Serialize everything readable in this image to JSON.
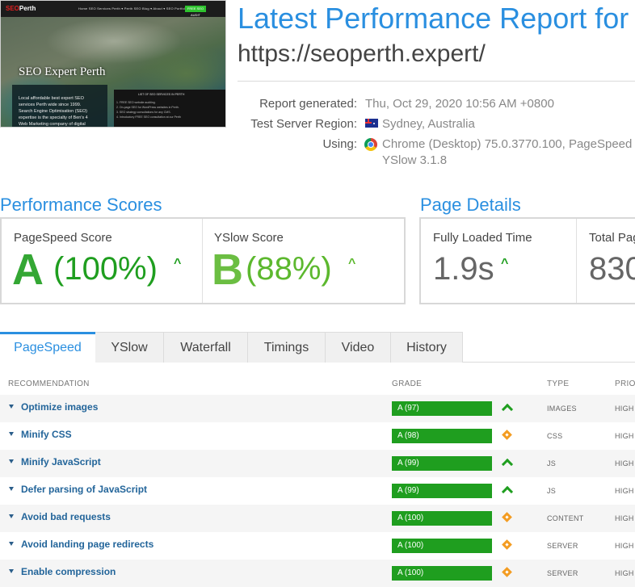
{
  "thumbnail": {
    "logo_brand": "SEO",
    "logo_rest": "Perth",
    "nav_links": "Home   SEO Services Perth ▾   Perth SEO Blog ▾   About ▾   SEO Portfolio",
    "nav_button": "FREE SEO AUDIT",
    "hero": "SEO Expert Perth",
    "hero_sub": "Local affordable best expert SEO",
    "text_lines": [
      "Local affordable best expert SEO",
      "services Perth wide since 1999.",
      "Search Engine Optimisation (SEO)",
      "expertise is the specialty of Ben's 4",
      "Web Marketing company of digital"
    ],
    "panel_title": "LIST OF SEO SERVICES IN PERTH",
    "panel_lines": [
      "1. FREE SEO website auditing.",
      "2. On-page SEO for WordPress websites in Perth.",
      "3. SEO strategy consultations for any CMS.",
      "4. Introductory FREE SEO consultation at our Perth"
    ]
  },
  "header": {
    "title": "Latest Performance Report for",
    "url": "https://seoperth.expert/"
  },
  "meta": {
    "report_generated_label": "Report generated:",
    "report_generated_value": "Thu, Oct 29, 2020 10:56 AM +0800",
    "region_label": "Test Server Region:",
    "region_value": "Sydney, Australia",
    "using_label": "Using:",
    "using_value_line1": "Chrome (Desktop) 75.0.3770.100, PageSpeed",
    "using_value_line2": "YSlow 3.1.8"
  },
  "performance_scores": {
    "title": "Performance Scores",
    "pagespeed": {
      "label": "PageSpeed Score",
      "grade": "A",
      "percent": "(100%)",
      "color": "#1f9e1f"
    },
    "yslow": {
      "label": "YSlow Score",
      "grade": "B",
      "percent": "(88%)",
      "color": "#5cb82e"
    }
  },
  "page_details": {
    "title": "Page Details",
    "fully_loaded": {
      "label": "Fully Loaded Time",
      "value": "1.9s"
    },
    "total_page": {
      "label": "Total Pag",
      "value": "830"
    }
  },
  "tabs": [
    "PageSpeed",
    "YSlow",
    "Waterfall",
    "Timings",
    "Video",
    "History"
  ],
  "table": {
    "headers": {
      "recommendation": "RECOMMENDATION",
      "grade": "GRADE",
      "type": "TYPE",
      "priority": "PRIO"
    },
    "rows": [
      {
        "rec": "Optimize images",
        "grade": "A (97)",
        "trend": "up",
        "type": "IMAGES",
        "priority": "HIGH"
      },
      {
        "rec": "Minify CSS",
        "grade": "A (98)",
        "trend": "neutral",
        "type": "CSS",
        "priority": "HIGH"
      },
      {
        "rec": "Minify JavaScript",
        "grade": "A (99)",
        "trend": "up",
        "type": "JS",
        "priority": "HIGH"
      },
      {
        "rec": "Defer parsing of JavaScript",
        "grade": "A (99)",
        "trend": "up",
        "type": "JS",
        "priority": "HIGH"
      },
      {
        "rec": "Avoid bad requests",
        "grade": "A (100)",
        "trend": "neutral",
        "type": "CONTENT",
        "priority": "HIGH"
      },
      {
        "rec": "Avoid landing page redirects",
        "grade": "A (100)",
        "trend": "neutral",
        "type": "SERVER",
        "priority": "HIGH"
      },
      {
        "rec": "Enable compression",
        "grade": "A (100)",
        "trend": "neutral",
        "type": "SERVER",
        "priority": "HIGH"
      }
    ]
  },
  "colors": {
    "accent": "#2a8fe0",
    "grade_bar": "#1f9e1f",
    "neutral_icon": "#f39c22"
  }
}
